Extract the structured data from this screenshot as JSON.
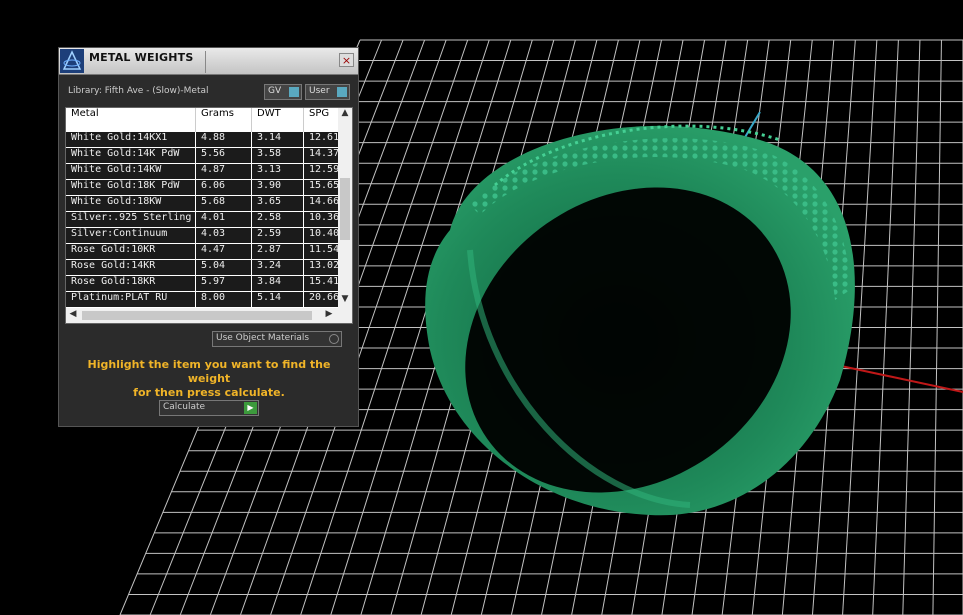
{
  "panel": {
    "title": "METAL WEIGHTS",
    "close_label": "×",
    "library_label": "Library: Fifth Ave - (Slow)-Metal",
    "toggles": [
      {
        "label": "GV"
      },
      {
        "label": "User"
      }
    ],
    "table": {
      "columns": [
        "Metal",
        "Grams",
        "DWT",
        "SPG"
      ],
      "rows": [
        [
          "White Gold:14KX1",
          "4.88",
          "3.14",
          "12.61"
        ],
        [
          "White Gold:14K PdW",
          "5.56",
          "3.58",
          "14.37"
        ],
        [
          "White Gold:14KW",
          "4.87",
          "3.13",
          "12.59"
        ],
        [
          "White Gold:18K PdW",
          "6.06",
          "3.90",
          "15.65"
        ],
        [
          "White Gold:18KW",
          "5.68",
          "3.65",
          "14.66"
        ],
        [
          "Silver:.925 Sterling",
          "4.01",
          "2.58",
          "10.36"
        ],
        [
          "Silver:Continuum",
          "4.03",
          "2.59",
          "10.40"
        ],
        [
          "Rose Gold:10KR",
          "4.47",
          "2.87",
          "11.54"
        ],
        [
          "Rose Gold:14KR",
          "5.04",
          "3.24",
          "13.02"
        ],
        [
          "Rose Gold:18KR",
          "5.97",
          "3.84",
          "15.41"
        ],
        [
          "Platinum:PLAT RU",
          "8.00",
          "5.14",
          "20.66"
        ]
      ]
    },
    "use_object_materials_label": "Use Object Materials",
    "hint_line1": "Highlight the item you want to find the weight",
    "hint_line2": "for then press calculate.",
    "calculate_label": "Calculate"
  },
  "colors": {
    "ring": "#1f8a5a",
    "grid": "#d8d8d8",
    "hint": "#f0b428",
    "axis_red": "#c01818",
    "axis_blue": "#3aa8c8"
  }
}
